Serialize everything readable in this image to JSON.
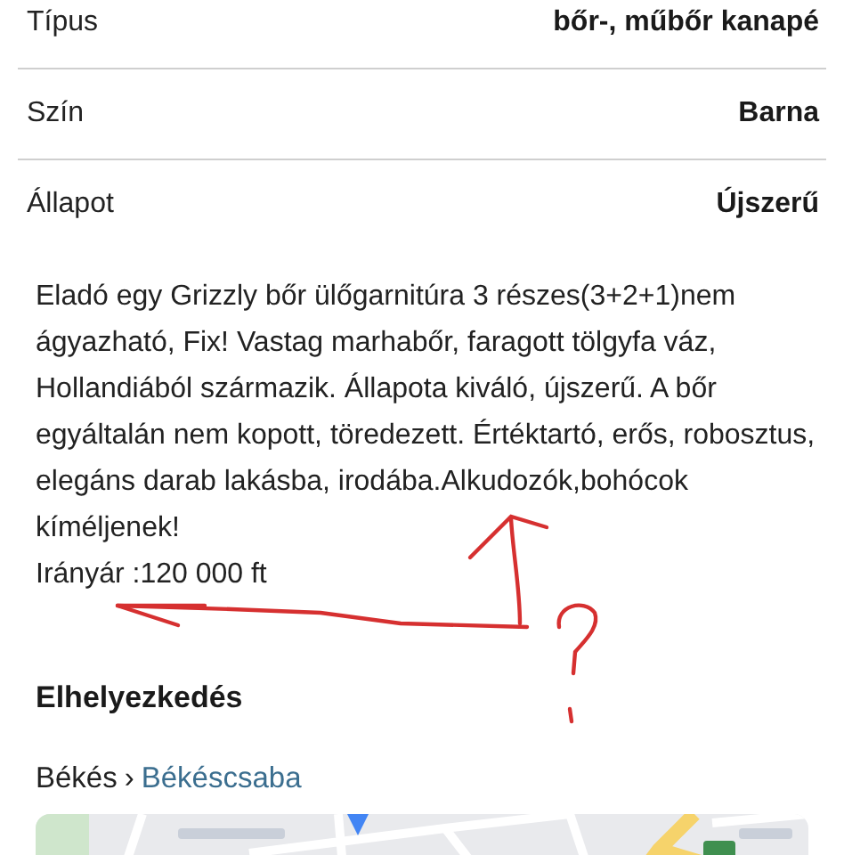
{
  "attributes": [
    {
      "label": "Típus",
      "value": "bőr-, műbőr kanapé"
    },
    {
      "label": "Szín",
      "value": "Barna"
    },
    {
      "label": "Állapot",
      "value": "Újszerű"
    }
  ],
  "description": [
    "Eladó egy Grizzly bőr ülőgarnitúra 3 részes(3+2+1)nem ágyazható, Fix! Vastag marhabőr, faragott tölgyfa váz, Hollandiából származik. Állapota kiváló, újszerű. A bőr egyáltalán nem kopott, töredezett. Értéktartó, erős, robosztus, elegáns darab lakásba, irodába.Alkudozók,bohócok kíméljenek!",
    "Irányár :120 000 ft"
  ],
  "location": {
    "heading": "Elhelyezkedés",
    "region": "Békés",
    "separator": "›",
    "city": "Békéscsaba"
  }
}
